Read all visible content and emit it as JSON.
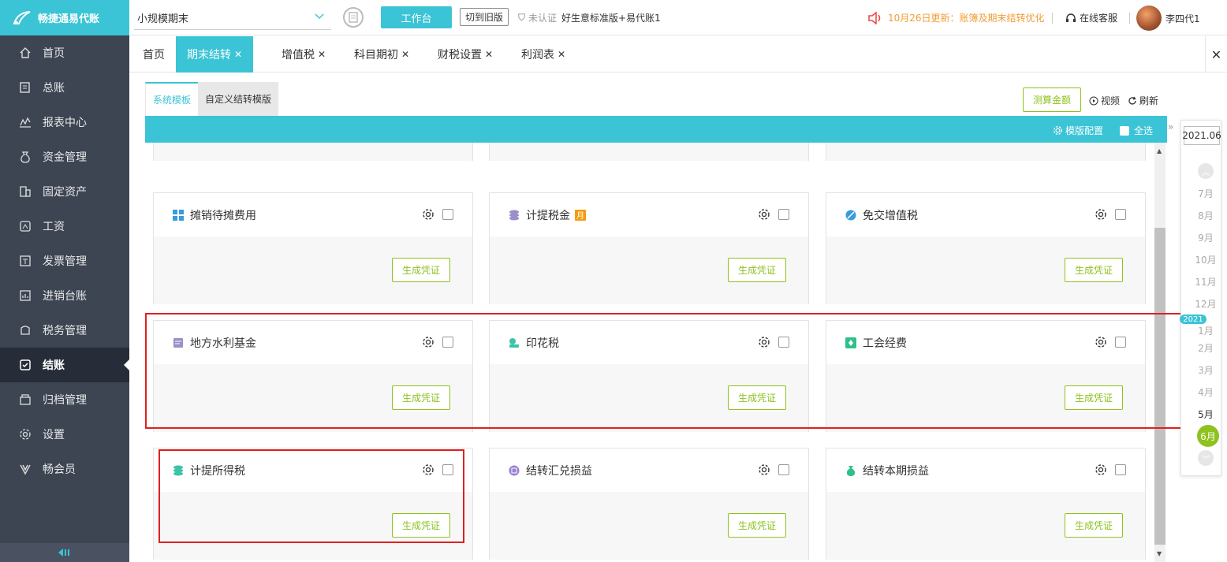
{
  "app": {
    "logo_text": "畅捷通易代账"
  },
  "sidebar": {
    "items": [
      {
        "label": "首页",
        "icon": "home-icon"
      },
      {
        "label": "总账",
        "icon": "ledger-icon"
      },
      {
        "label": "报表中心",
        "icon": "report-chart-icon"
      },
      {
        "label": "资金管理",
        "icon": "money-bag-icon"
      },
      {
        "label": "固定资产",
        "icon": "building-icon"
      },
      {
        "label": "工资",
        "icon": "salary-icon"
      },
      {
        "label": "发票管理",
        "icon": "invoice-icon"
      },
      {
        "label": "进销台账",
        "icon": "inventory-icon"
      },
      {
        "label": "税务管理",
        "icon": "tax-icon"
      },
      {
        "label": "结账",
        "icon": "checkout-icon"
      },
      {
        "label": "归档管理",
        "icon": "archive-icon"
      },
      {
        "label": "设置",
        "icon": "gear-icon"
      },
      {
        "label": "畅会员",
        "icon": "vip-icon"
      }
    ],
    "active_index": 9
  },
  "topbar": {
    "company": "小规模期末",
    "workbench": "工作台",
    "old_version": "切到旧版",
    "uncertified": "未认证",
    "plan": "好生意标准版+易代账1",
    "notice": "10月26日更新：账簿及期末结转优化",
    "service": "在线客服",
    "user": "李四代1"
  },
  "tabs": [
    {
      "label": "首页",
      "closable": false
    },
    {
      "label": "期末结转",
      "closable": true
    },
    {
      "label": "增值税",
      "closable": true
    },
    {
      "label": "科目期初",
      "closable": true
    },
    {
      "label": "财税设置",
      "closable": true
    },
    {
      "label": "利润表",
      "closable": true
    }
  ],
  "subtabs": [
    "系统模板",
    "自定义结转模版"
  ],
  "actions": {
    "calc": "测算金额",
    "video": "视频",
    "refresh": "刷新"
  },
  "toolbar": {
    "template_config": "模版配置",
    "select_all": "全选"
  },
  "generate_label": "生成凭证",
  "cards": [
    {
      "title": "",
      "icon": "",
      "color": "#3bc4d6"
    },
    {
      "title": "",
      "icon": "",
      "color": "#3bc4d6"
    },
    {
      "title": "",
      "icon": "",
      "color": "#3bc4d6"
    },
    {
      "title": "摊销待摊费用",
      "icon": "windows-grid-icon",
      "color": "#3a9bdc"
    },
    {
      "title": "计提税金",
      "icon": "coins-stack-icon",
      "color": "#9b8ec9",
      "badge": "月"
    },
    {
      "title": "免交增值税",
      "icon": "no-tax-icon",
      "color": "#3a9bdc"
    },
    {
      "title": "地方水利基金",
      "icon": "note-icon",
      "color": "#9b8ec9"
    },
    {
      "title": "印花税",
      "icon": "stamp-icon",
      "color": "#3bc4a6"
    },
    {
      "title": "工会经费",
      "icon": "union-icon",
      "color": "#2ec08a"
    },
    {
      "title": "计提所得税",
      "icon": "coins-stack-icon",
      "color": "#3bc4a6"
    },
    {
      "title": "结转汇兑损益",
      "icon": "exchange-icon",
      "color": "#9b7fd4"
    },
    {
      "title": "结转本期损益",
      "icon": "money-bag-icon",
      "color": "#2ec08a"
    }
  ],
  "period": {
    "date": "2021.06",
    "months": [
      "7月",
      "8月",
      "9月",
      "10月",
      "11月",
      "12月",
      "1月",
      "2月",
      "3月",
      "4月",
      "5月",
      "6月"
    ],
    "year_badge": "2021",
    "current": "6月"
  }
}
